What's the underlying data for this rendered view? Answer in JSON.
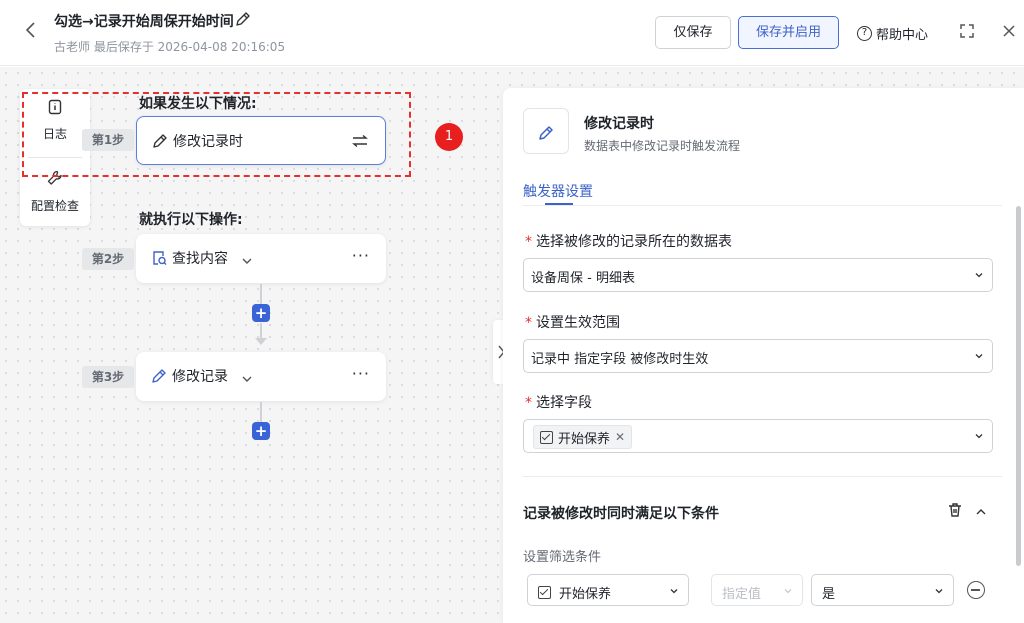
{
  "header": {
    "title": "勾选→记录开始周保开始时间",
    "subtitle": "古老师 最后保存于 2026-04-08 20:16:05",
    "save_only": "仅保存",
    "save_enable": "保存并启用",
    "help": "帮助中心",
    "help_icon_char": "?"
  },
  "toolbar": {
    "log": "日志",
    "config_check": "配置检查"
  },
  "flow": {
    "trigger_heading": "如果发生以下情况:",
    "action_heading": "就执行以下操作:",
    "steps": [
      {
        "tag": "第1步",
        "name": "修改记录时",
        "icon": "pencil-icon"
      },
      {
        "tag": "第2步",
        "name": "查找内容",
        "icon": "search-doc-icon"
      },
      {
        "tag": "第3步",
        "name": "修改记录",
        "icon": "pencil-icon"
      }
    ],
    "more": "···",
    "plus": "+",
    "badge": "1"
  },
  "panel": {
    "title": "修改记录时",
    "desc": "数据表中修改记录时触发流程",
    "tab": "触发器设置",
    "fields": [
      {
        "label": "选择被修改的记录所在的数据表",
        "value": "设备周保 - 明细表"
      },
      {
        "label": "设置生效范围",
        "value": "记录中 指定字段 被修改时生效"
      },
      {
        "label": "选择字段",
        "tag": "开始保养",
        "tag_close": "✕"
      }
    ],
    "required_mark": "*",
    "condition_title": "记录被修改时同时满足以下条件",
    "filter_label": "设置筛选条件",
    "filter": {
      "field": "开始保养",
      "operator": "指定值",
      "value": "是"
    }
  },
  "colors": {
    "primary": "#3d63c9",
    "danger": "#e53030",
    "plus": "#3a63d8"
  }
}
